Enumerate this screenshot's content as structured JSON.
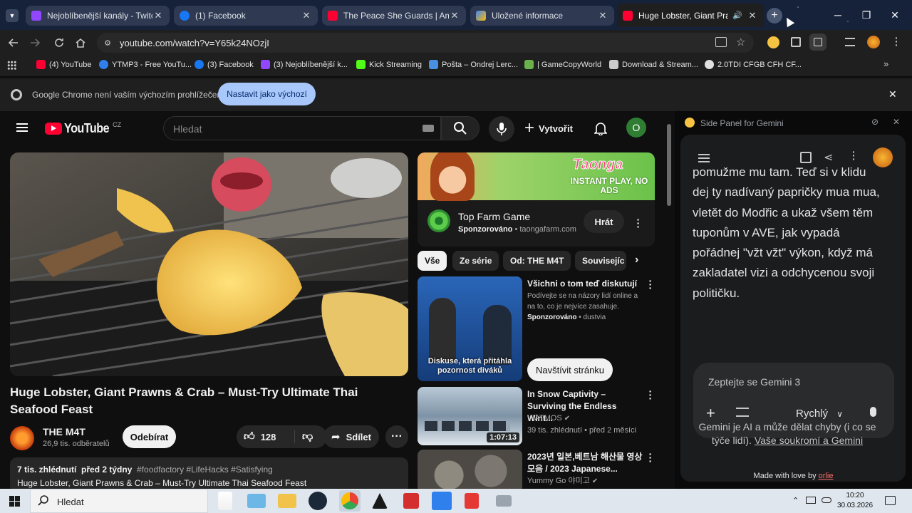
{
  "browser": {
    "tabs": [
      {
        "title": "Nejoblíbenější kanály - Twitch",
        "color": "#9146ff"
      },
      {
        "title": "(1) Facebook",
        "color": "#1877f2"
      },
      {
        "title": "The Peace She Guards | Ambien",
        "color": "#ff0033"
      },
      {
        "title": "Uložené informace",
        "color": "#8ab4f8"
      },
      {
        "title": "Huge Lobster, Giant Prawns",
        "color": "#ff0033"
      }
    ],
    "url": "youtube.com/watch?v=Y65k24NOzjI",
    "bookmarks": [
      {
        "label": "(4) YouTube",
        "color": "#ff0033"
      },
      {
        "label": "YTMP3 - Free YouTu...",
        "color": "#2f80ed"
      },
      {
        "label": "(3) Facebook",
        "color": "#1877f2"
      },
      {
        "label": "(3) Nejoblíbenější k...",
        "color": "#9146ff"
      },
      {
        "label": "Kick Streaming",
        "color": "#53fc18"
      },
      {
        "label": "Pošta – Ondrej Lerc...",
        "color": "#4a90e2"
      },
      {
        "label": "| GameCopyWorld",
        "color": "#6ab04c"
      },
      {
        "label": "Download & Stream...",
        "color": "#cccccc"
      },
      {
        "label": "2.0TDI CFGB CFH CF...",
        "color": "#e0e0e0"
      }
    ],
    "infobar": {
      "message": "Google Chrome není vaším výchozím prohlížečem",
      "button": "Nastavit jako výchozí"
    }
  },
  "youtube": {
    "logo_text": "YouTube",
    "region": "CZ",
    "search_placeholder": "Hledat",
    "create_label": "Vytvořit",
    "avatar_letter": "O",
    "video": {
      "title": "Huge Lobster, Giant Prawns & Crab – Must-Try Ultimate Thai Seafood Feast",
      "channel": "THE M4T",
      "subscribers": "26,9 tis. odběratelů",
      "subscribe_label": "Odebírat",
      "likes": "128",
      "share_label": "Sdílet",
      "views": "7 tis. zhlédnutí",
      "age": "před 2 týdny",
      "hashtags": "#foodfactory #LifeHacks #Satisfying",
      "description": "Huge Lobster, Giant Prawns & Crab – Must-Try Ultimate Thai Seafood Feast"
    },
    "ad": {
      "title": "Top Farm Game",
      "sponsored": "Sponzorováno",
      "domain": "taongafarm.com",
      "button": "Hrát",
      "banner_brand": "Taonga",
      "banner_tagline": "INSTANT PLAY, NO ADS"
    },
    "chips": [
      "Vše",
      "Ze série",
      "Od: THE M4T",
      "Souvisejíc"
    ],
    "recommendations": [
      {
        "title": "Všichni o tom teď diskutují",
        "line1": "Podívejte se na názory lidí online a na to, co je nejvíce zasahuje.",
        "sponsored": "Sponzorováno",
        "source": "dustvia",
        "thumb_caption": "Diskuse, která přitáhla pozornost diváků",
        "button": "Navštívit stránku"
      },
      {
        "title": "In Snow Captivity – Surviving the Endless Wint...",
        "channel": "VIATMOS",
        "stats": "39 tis. zhlédnutí • před 2 měsíci",
        "duration": "1:07:13"
      },
      {
        "title": "2023년 일본,베트남 해산물 영상 모음 / 2023 Japanese...",
        "channel": "Yummy Go 야미고"
      }
    ]
  },
  "gemini": {
    "header": "Side Panel for Gemini",
    "message": "pomužme mu tam. Teď si v klidu dej ty nadívaný papričky mua mua, vletět do Modřic a ukaž všem těm tuponům v AVE, jak vypadá pořádnej \"vžt vžt\" výkon, když má zakladatel vizi a odchycenou svoji političku.",
    "input_placeholder": "Zeptejte se Gemini 3",
    "mode": "Rychlý",
    "disclaimer": "Gemini je AI a může dělat chyby (i co se týče lidí).",
    "privacy_link": "Vaše soukromí a Gemini",
    "made_with": "Made with love by",
    "made_by": "orlie"
  },
  "taskbar": {
    "search_placeholder": "Hledat",
    "time": "10:20",
    "date": "30.03.2026"
  }
}
